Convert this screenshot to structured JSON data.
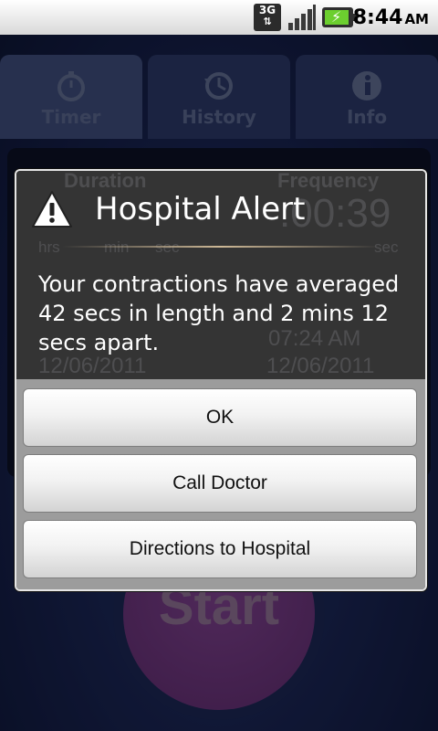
{
  "status_bar": {
    "network": "3G",
    "time": "8:44",
    "ampm": "AM",
    "icons": [
      "3g-data-icon",
      "signal-strength-icon",
      "battery-charging-icon"
    ]
  },
  "tabs": [
    {
      "label": "Timer",
      "icon": "stopwatch-icon",
      "active": true
    },
    {
      "label": "History",
      "icon": "history-clock-icon",
      "active": false
    },
    {
      "label": "Info",
      "icon": "info-icon",
      "active": false
    }
  ],
  "background_panel": {
    "duration_header": "Duration",
    "frequency_header": "Frequency",
    "frequency_value": ":00:39",
    "unit_hrs": "hrs",
    "unit_min": "min",
    "unit_sec": "sec",
    "unit_sec_right": "sec",
    "time_right": "07:24 AM",
    "date_left": "12/06/2011",
    "date_right": "12/06/2011"
  },
  "start_button": {
    "label": "Start"
  },
  "dialog": {
    "icon": "warning-icon",
    "title": "Hospital Alert",
    "message": "Your contractions have averaged 42 secs in length and 2 mins 12 secs apart.",
    "buttons": {
      "ok": "OK",
      "call_doctor": "Call Doctor",
      "directions": "Directions to Hospital"
    }
  },
  "colors": {
    "app_background": "#17224e",
    "dialog_background": "#343434",
    "start_button": "#6a3479",
    "battery_fill": "#6ccf2f"
  }
}
